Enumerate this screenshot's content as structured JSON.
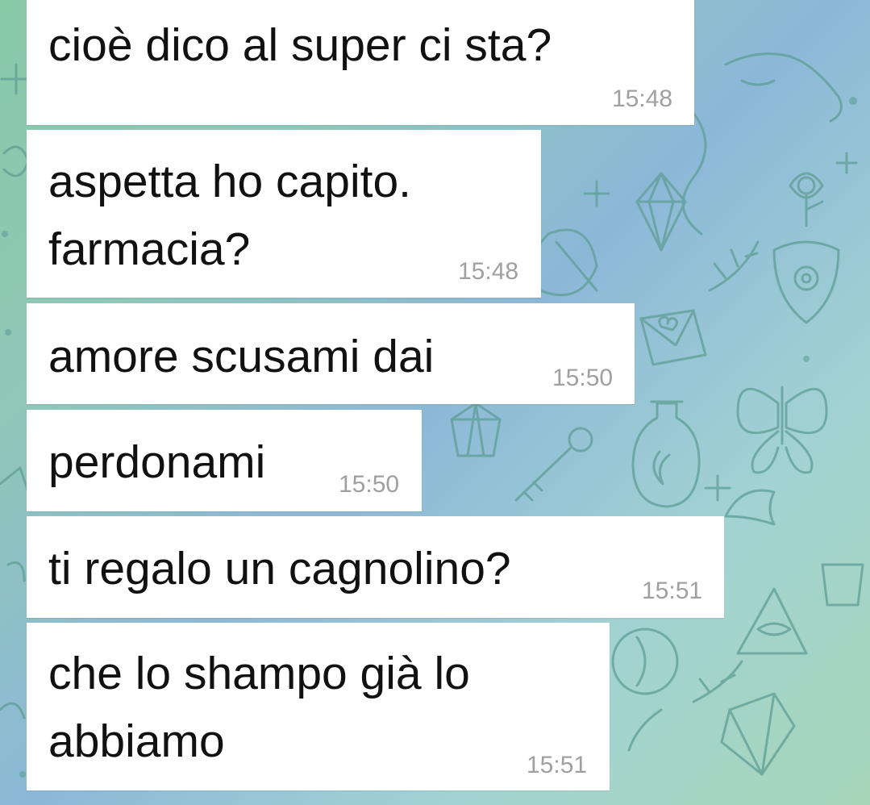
{
  "colors": {
    "bubble_bg": "#ffffff",
    "message_text": "#111111",
    "timestamp": "#a0a0a0",
    "wallpaper_pattern": "#5f9e96"
  },
  "messages": [
    {
      "text": "cioè dico al super ci sta?",
      "time": "15:48"
    },
    {
      "text": "aspetta ho capito.\nfarmacia?",
      "time": "15:48"
    },
    {
      "text": "amore scusami dai",
      "time": "15:50"
    },
    {
      "text": "perdonami",
      "time": "15:50"
    },
    {
      "text": "ti regalo un cagnolino?",
      "time": "15:51"
    },
    {
      "text": "che lo shampo già lo\nabbiamo",
      "time": "15:51"
    }
  ]
}
